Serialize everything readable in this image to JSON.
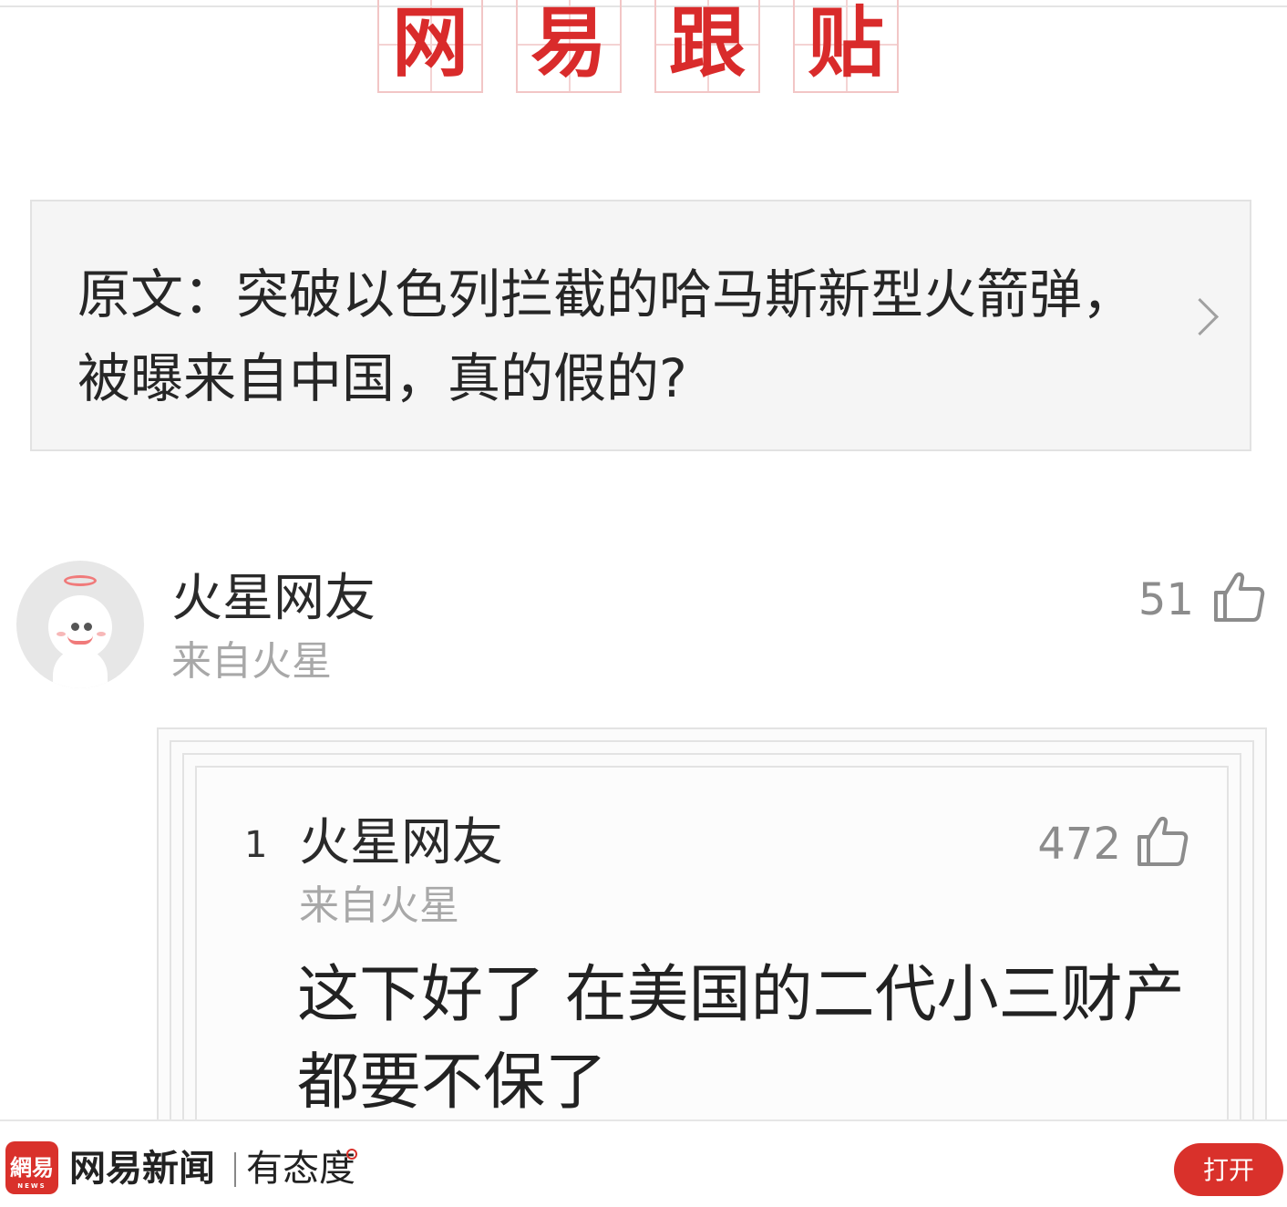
{
  "banner": {
    "chars": [
      "网",
      "易",
      "跟",
      "贴"
    ]
  },
  "original": {
    "text": "原文：突破以色列拦截的哈马斯新型火箭弹，被曝来自中国，真的假的?"
  },
  "comment": {
    "user_name": "火星网友",
    "location": "来自火星",
    "likes": "51"
  },
  "reply": {
    "floor": "1",
    "user_name": "火星网友",
    "location": "来自火星",
    "likes": "472",
    "text": "这下好了 在美国的二代小三财产都要不保了"
  },
  "footer": {
    "logo_text": "網易",
    "logo_sub": "NEWS",
    "brand": "网易新闻",
    "slogan": "有态度",
    "open_button": "打开"
  },
  "colors": {
    "accent": "#d92b2b",
    "banner_border": "#f2c6c6",
    "muted_text": "#a8a8a8"
  },
  "icons": [
    "chevron-right-icon",
    "thumbs-up-icon",
    "avatar-mascot"
  ]
}
